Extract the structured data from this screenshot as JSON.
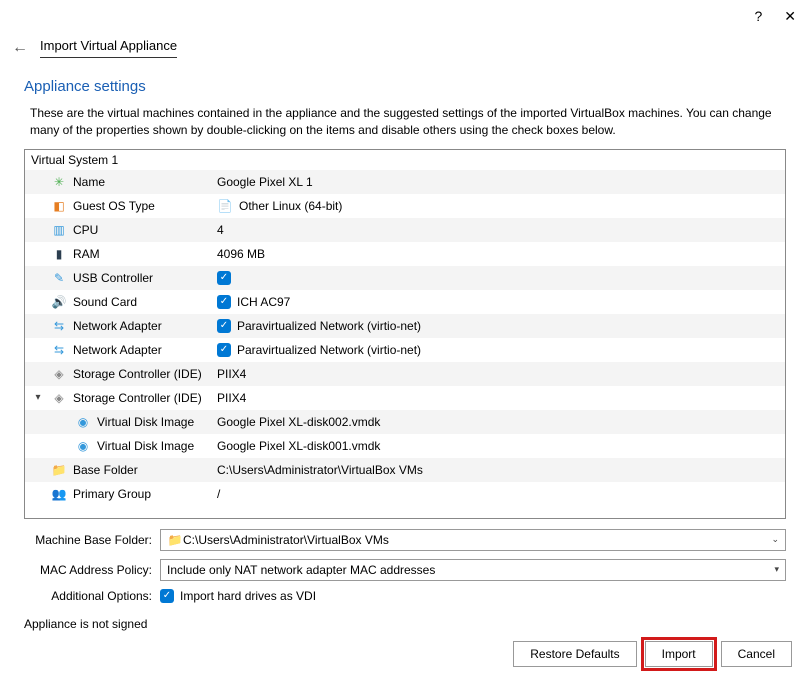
{
  "titlebar": {
    "help": "?",
    "close": "✕"
  },
  "header": {
    "title": "Import Virtual Appliance"
  },
  "section": {
    "title": "Appliance settings",
    "description": "These are the virtual machines contained in the appliance and the suggested settings of the imported VirtualBox machines. You can change many of the properties shown by double-clicking on the items and disable others using the check boxes below."
  },
  "system": {
    "header": "Virtual System 1",
    "rows": [
      {
        "label": "Name",
        "value": "Google Pixel XL 1",
        "iconColor": "#4caf50",
        "glyph": "✳",
        "check": false
      },
      {
        "label": "Guest OS Type",
        "value": "Other Linux (64-bit)",
        "iconColor": "#e67e22",
        "glyph": "◧",
        "check": false,
        "valIcon": "📄",
        "valIconColor": "#f1c40f"
      },
      {
        "label": "CPU",
        "value": "4",
        "iconColor": "#3498db",
        "glyph": "▥",
        "check": false
      },
      {
        "label": "RAM",
        "value": "4096 MB",
        "iconColor": "#2c3e50",
        "glyph": "▮",
        "check": false
      },
      {
        "label": "USB Controller",
        "value": "",
        "iconColor": "#3498db",
        "glyph": "✎",
        "check": true
      },
      {
        "label": "Sound Card",
        "value": "ICH AC97",
        "iconColor": "#3498db",
        "glyph": "🔊",
        "check": true
      },
      {
        "label": "Network Adapter",
        "value": "Paravirtualized Network (virtio-net)",
        "iconColor": "#3498db",
        "glyph": "⇆",
        "check": true
      },
      {
        "label": "Network Adapter",
        "value": "Paravirtualized Network (virtio-net)",
        "iconColor": "#3498db",
        "glyph": "⇆",
        "check": true
      },
      {
        "label": "Storage Controller (IDE)",
        "value": "PIIX4",
        "iconColor": "#888",
        "glyph": "◈",
        "check": false
      },
      {
        "label": "Storage Controller (IDE)",
        "value": "PIIX4",
        "iconColor": "#888",
        "glyph": "◈",
        "check": false,
        "expand": "▾"
      },
      {
        "label": "Virtual Disk Image",
        "value": "Google Pixel XL-disk002.vmdk",
        "iconColor": "#3498db",
        "glyph": "◉",
        "check": false,
        "indent": true
      },
      {
        "label": "Virtual Disk Image",
        "value": "Google Pixel XL-disk001.vmdk",
        "iconColor": "#3498db",
        "glyph": "◉",
        "check": false,
        "indent": true
      },
      {
        "label": "Base Folder",
        "value": "C:\\Users\\Administrator\\VirtualBox VMs",
        "iconColor": "#f1c40f",
        "glyph": "📁",
        "check": false
      },
      {
        "label": "Primary Group",
        "value": "/",
        "iconColor": "#e67e22",
        "glyph": "👥",
        "check": false
      }
    ]
  },
  "form": {
    "baseFolderLabel": "Machine Base Folder:",
    "baseFolderValue": "C:\\Users\\Administrator\\VirtualBox VMs",
    "macLabel": "MAC Address Policy:",
    "macValue": "Include only NAT network adapter MAC addresses",
    "optLabel": "Additional Options:",
    "optCheck": "Import hard drives as VDI",
    "notSigned": "Appliance is not signed"
  },
  "buttons": {
    "restore": "Restore Defaults",
    "import": "Import",
    "cancel": "Cancel"
  }
}
